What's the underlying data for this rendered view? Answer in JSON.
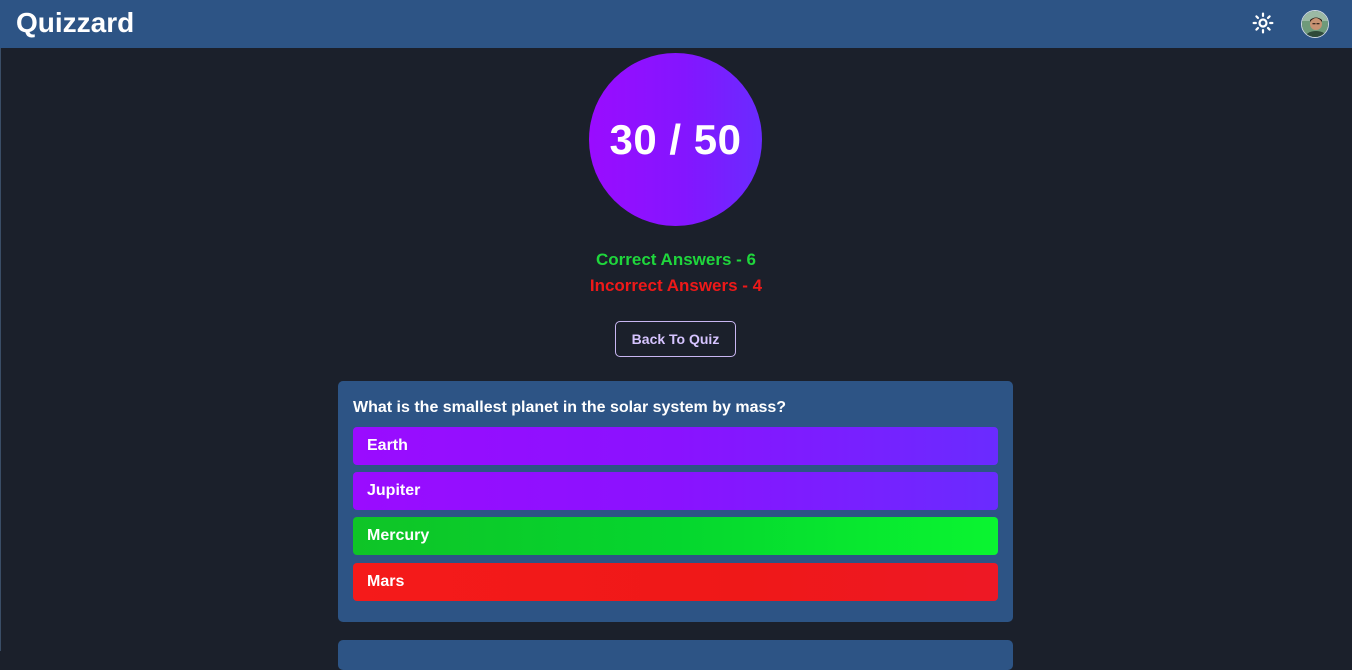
{
  "navbar": {
    "brand": "Quizzard",
    "theme_icon": "sun-icon",
    "avatar_icon": "user-avatar"
  },
  "result": {
    "score": "30 / 50",
    "correct_label": "Correct Answers - 6",
    "incorrect_label": "Incorrect Answers - 4",
    "back_button": "Back To Quiz"
  },
  "questions": [
    {
      "text": "What is the smallest planet in the solar system by mass?",
      "options": [
        {
          "label": "Earth",
          "state": "neutral"
        },
        {
          "label": "Jupiter",
          "state": "neutral"
        },
        {
          "label": "Mercury",
          "state": "correct"
        },
        {
          "label": "Mars",
          "state": "incorrect"
        }
      ]
    }
  ],
  "colors": {
    "navbar": "#2d5485",
    "background": "#1b202b",
    "accent_purple": "#8a12ff",
    "correct_green": "#1fd63c",
    "incorrect_red": "#ee1919"
  }
}
